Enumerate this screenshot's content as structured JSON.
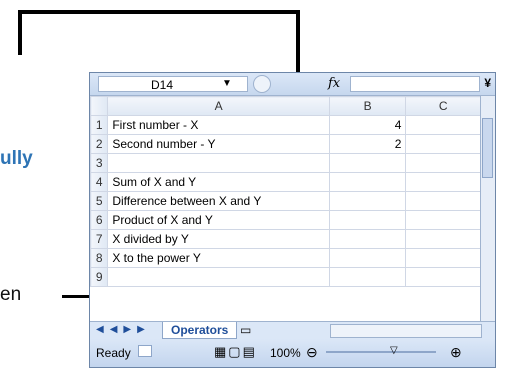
{
  "callouts": {
    "top": "ully",
    "bottom": "en"
  },
  "formula_bar": {
    "name_box": "D14",
    "fx_label": "fx",
    "formula": ""
  },
  "columns": [
    "A",
    "B",
    "C"
  ],
  "rows": [
    {
      "n": "1",
      "a": "First number - X",
      "b": "4"
    },
    {
      "n": "2",
      "a": "Second number - Y",
      "b": "2"
    },
    {
      "n": "3",
      "a": "",
      "b": ""
    },
    {
      "n": "4",
      "a": "Sum of X and Y",
      "b": ""
    },
    {
      "n": "5",
      "a": "Difference between X and Y",
      "b": ""
    },
    {
      "n": "6",
      "a": "Product of X and Y",
      "b": ""
    },
    {
      "n": "7",
      "a": "X divided by Y",
      "b": ""
    },
    {
      "n": "8",
      "a": "X to the power Y",
      "b": ""
    },
    {
      "n": "9",
      "a": "",
      "b": ""
    }
  ],
  "sheet_tab": "Operators",
  "status": {
    "ready": "Ready",
    "zoom": "100%"
  }
}
